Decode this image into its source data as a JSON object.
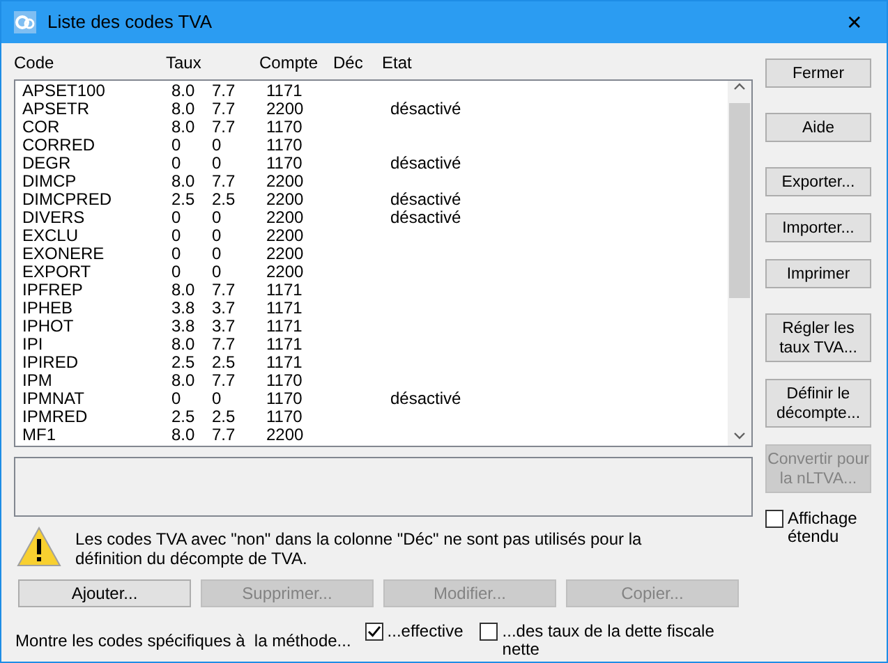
{
  "window": {
    "title": "Liste des codes TVA",
    "close": "✕"
  },
  "table": {
    "columns": [
      "Code",
      "Taux",
      "Compte",
      "Déc",
      "Etat"
    ],
    "rows": [
      {
        "code": "APSET100",
        "taux_1": "8.0",
        "taux_2": "7.7",
        "compte": "1171",
        "etat": ""
      },
      {
        "code": "APSETR",
        "taux_1": "8.0",
        "taux_2": "7.7",
        "compte": "2200",
        "etat": "désactivé"
      },
      {
        "code": "COR",
        "taux_1": "8.0",
        "taux_2": "7.7",
        "compte": "1170",
        "etat": ""
      },
      {
        "code": "CORRED",
        "taux_1": "0",
        "taux_2": "0",
        "compte": "1170",
        "etat": ""
      },
      {
        "code": "DEGR",
        "taux_1": "0",
        "taux_2": "0",
        "compte": "1170",
        "etat": "désactivé"
      },
      {
        "code": "DIMCP",
        "taux_1": "8.0",
        "taux_2": "7.7",
        "compte": "2200",
        "etat": ""
      },
      {
        "code": "DIMCPRED",
        "taux_1": "2.5",
        "taux_2": "2.5",
        "compte": "2200",
        "etat": "désactivé"
      },
      {
        "code": "DIVERS",
        "taux_1": "0",
        "taux_2": "0",
        "compte": "2200",
        "etat": "désactivé"
      },
      {
        "code": "EXCLU",
        "taux_1": "0",
        "taux_2": "0",
        "compte": "2200",
        "etat": ""
      },
      {
        "code": "EXONERE",
        "taux_1": "0",
        "taux_2": "0",
        "compte": "2200",
        "etat": ""
      },
      {
        "code": "EXPORT",
        "taux_1": "0",
        "taux_2": "0",
        "compte": "2200",
        "etat": ""
      },
      {
        "code": "IPFREP",
        "taux_1": "8.0",
        "taux_2": "7.7",
        "compte": "1171",
        "etat": ""
      },
      {
        "code": "IPHEB",
        "taux_1": "3.8",
        "taux_2": "3.7",
        "compte": "1171",
        "etat": ""
      },
      {
        "code": "IPHOT",
        "taux_1": "3.8",
        "taux_2": "3.7",
        "compte": "1171",
        "etat": ""
      },
      {
        "code": "IPI",
        "taux_1": "8.0",
        "taux_2": "7.7",
        "compte": "1171",
        "etat": ""
      },
      {
        "code": "IPIRED",
        "taux_1": "2.5",
        "taux_2": "2.5",
        "compte": "1171",
        "etat": ""
      },
      {
        "code": "IPM",
        "taux_1": "8.0",
        "taux_2": "7.7",
        "compte": "1170",
        "etat": ""
      },
      {
        "code": "IPMNAT",
        "taux_1": "0",
        "taux_2": "0",
        "compte": "1170",
        "etat": "désactivé"
      },
      {
        "code": "IPMRED",
        "taux_1": "2.5",
        "taux_2": "2.5",
        "compte": "1170",
        "etat": ""
      },
      {
        "code": "MF1",
        "taux_1": "8.0",
        "taux_2": "7.7",
        "compte": "2200",
        "etat": ""
      }
    ]
  },
  "side_button_groups": [
    [
      {
        "label": "Fermer",
        "disabled": false
      }
    ],
    [
      {
        "label": "Aide",
        "disabled": false
      }
    ],
    [
      {
        "label": "Exporter...",
        "disabled": false
      },
      {
        "label": "Importer...",
        "disabled": false
      },
      {
        "label": "Imprimer",
        "disabled": false
      }
    ],
    [
      {
        "label": "Régler les taux TVA...",
        "disabled": false
      },
      {
        "label": "Définir le décompte...",
        "disabled": false
      },
      {
        "label": "Convertir pour la nLTVA...",
        "disabled": true
      }
    ]
  ],
  "extended_view": {
    "label": "Affichage étendu",
    "checked": false
  },
  "warning": "Les codes TVA avec \"non\" dans la colonne \"Déc\" ne sont pas utilisés pour la définition du décompte de TVA.",
  "bottom_buttons": [
    {
      "label": "Ajouter...",
      "disabled": false
    },
    {
      "label": "Supprimer...",
      "disabled": true
    },
    {
      "label": "Modifier...",
      "disabled": true
    },
    {
      "label": "Copier...",
      "disabled": true
    }
  ],
  "filter": {
    "label": "Montre les codes spécifiques à  la méthode...",
    "options": [
      {
        "label": "...effective",
        "checked": true
      },
      {
        "label": "...des taux de la dette fiscale nette",
        "checked": false
      }
    ]
  }
}
